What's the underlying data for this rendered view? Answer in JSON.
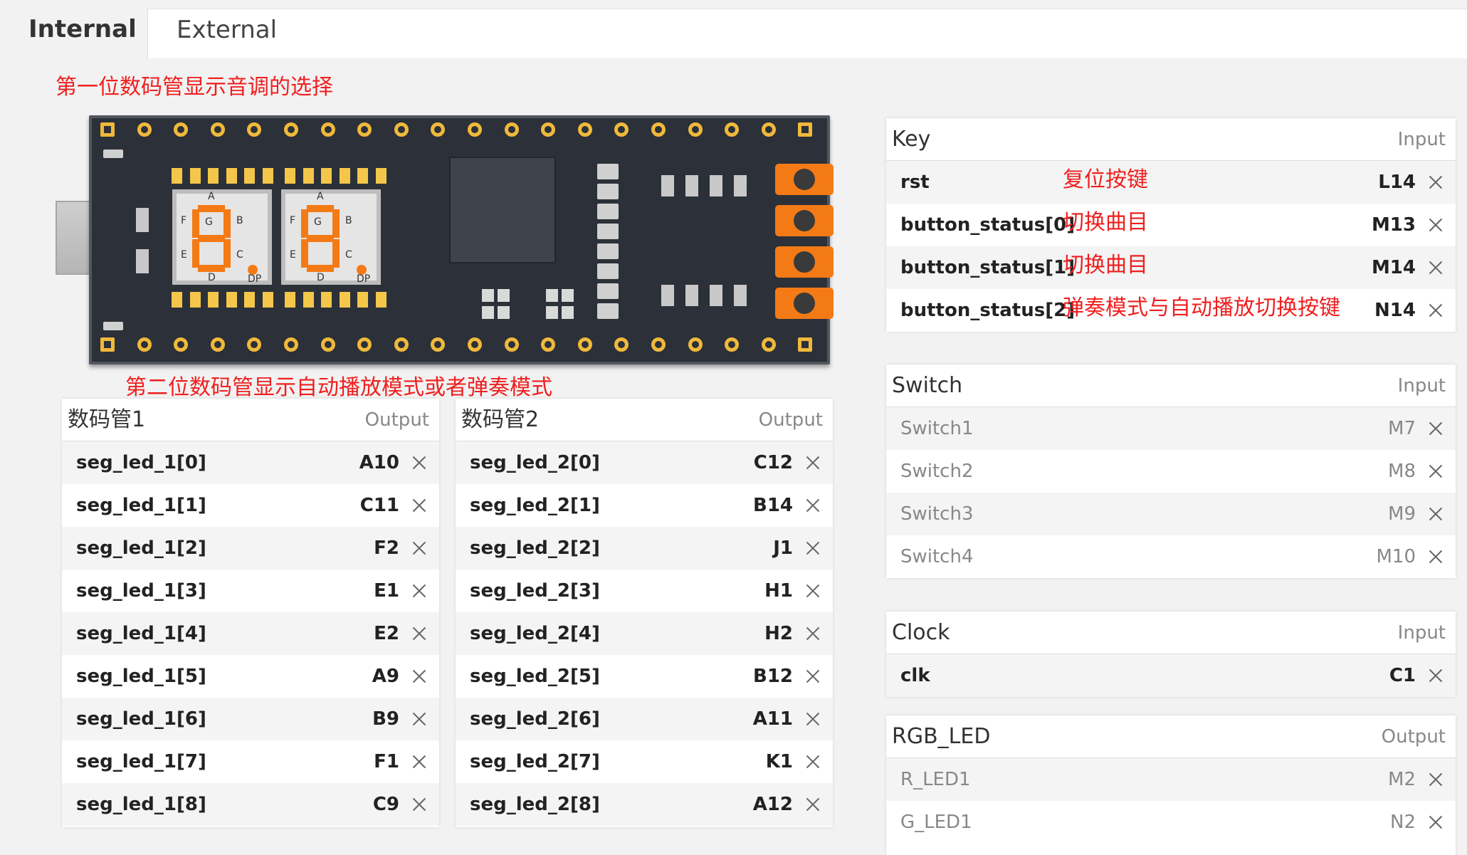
{
  "tabs": [
    {
      "label": "Internal",
      "active": true
    },
    {
      "label": "External",
      "active": false
    }
  ],
  "annotations": {
    "top": "第一位数码管显示音调的选择",
    "middle": "第二位数码管显示自动播放模式或者弹奏模式"
  },
  "board": {
    "digit1": {
      "a": "A",
      "b": "B",
      "c": "C",
      "d": "D",
      "e": "E",
      "f": "F",
      "g": "G",
      "dp": "DP"
    },
    "digit2": {
      "a": "A",
      "b": "B",
      "c": "C",
      "d": "D",
      "e": "E",
      "f": "F",
      "g": "G",
      "dp": "DP"
    }
  },
  "seg1": {
    "title": "数码管1",
    "direction": "Output",
    "rows": [
      {
        "name": "seg_led_1[0]",
        "pin": "A10"
      },
      {
        "name": "seg_led_1[1]",
        "pin": "C11"
      },
      {
        "name": "seg_led_1[2]",
        "pin": "F2"
      },
      {
        "name": "seg_led_1[3]",
        "pin": "E1"
      },
      {
        "name": "seg_led_1[4]",
        "pin": "E2"
      },
      {
        "name": "seg_led_1[5]",
        "pin": "A9"
      },
      {
        "name": "seg_led_1[6]",
        "pin": "B9"
      },
      {
        "name": "seg_led_1[7]",
        "pin": "F1"
      },
      {
        "name": "seg_led_1[8]",
        "pin": "C9"
      }
    ]
  },
  "seg2": {
    "title": "数码管2",
    "direction": "Output",
    "rows": [
      {
        "name": "seg_led_2[0]",
        "pin": "C12"
      },
      {
        "name": "seg_led_2[1]",
        "pin": "B14"
      },
      {
        "name": "seg_led_2[2]",
        "pin": "J1"
      },
      {
        "name": "seg_led_2[3]",
        "pin": "H1"
      },
      {
        "name": "seg_led_2[4]",
        "pin": "H2"
      },
      {
        "name": "seg_led_2[5]",
        "pin": "B12"
      },
      {
        "name": "seg_led_2[6]",
        "pin": "A11"
      },
      {
        "name": "seg_led_2[7]",
        "pin": "K1"
      },
      {
        "name": "seg_led_2[8]",
        "pin": "A12"
      }
    ]
  },
  "key": {
    "title": "Key",
    "direction": "Input",
    "rows": [
      {
        "name": "rst",
        "pin": "L14",
        "note": "复位按键"
      },
      {
        "name": "button_status[0]",
        "pin": "M13",
        "note": "切换曲目"
      },
      {
        "name": "button_status[1]",
        "pin": "M14",
        "note": "切换曲目"
      },
      {
        "name": "button_status[2]",
        "pin": "N14",
        "note": "弹奏模式与自动播放切换按键"
      }
    ]
  },
  "switch": {
    "title": "Switch",
    "direction": "Input",
    "rows": [
      {
        "name": "Switch1",
        "pin": "M7"
      },
      {
        "name": "Switch2",
        "pin": "M8"
      },
      {
        "name": "Switch3",
        "pin": "M9"
      },
      {
        "name": "Switch4",
        "pin": "M10"
      }
    ]
  },
  "clock": {
    "title": "Clock",
    "direction": "Input",
    "rows": [
      {
        "name": "clk",
        "pin": "C1"
      }
    ]
  },
  "rgb": {
    "title": "RGB_LED",
    "direction": "Output",
    "rows": [
      {
        "name": "R_LED1",
        "pin": "M2"
      },
      {
        "name": "G_LED1",
        "pin": "N2"
      }
    ]
  },
  "colors": {
    "accent": "#f47a15",
    "annotation": "#f01f1f",
    "pcb": "#2c3039",
    "pin": "#f0b93a"
  },
  "icons": {
    "remove": "close-icon"
  }
}
